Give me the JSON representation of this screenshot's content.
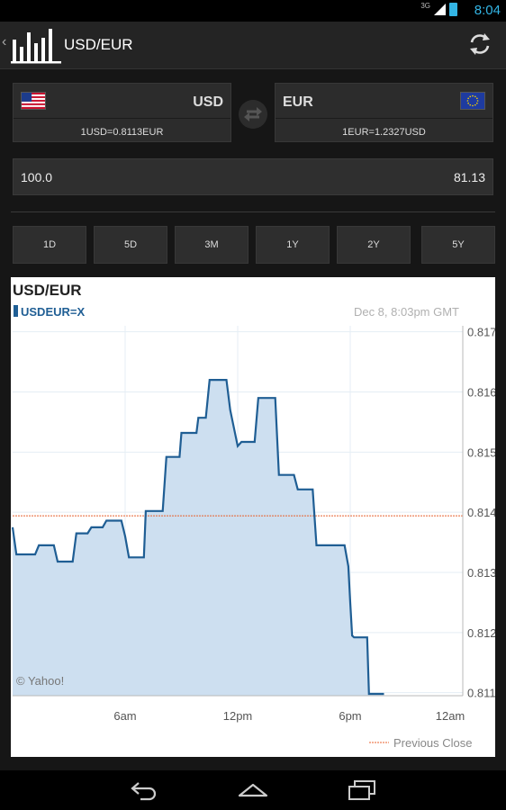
{
  "status_bar": {
    "network": "3G",
    "time": "8:04"
  },
  "action_bar": {
    "title": "USD/EUR"
  },
  "from": {
    "code": "USD",
    "rate": "1USD=0.8113EUR"
  },
  "to": {
    "code": "EUR",
    "rate": "1EUR=1.2327USD"
  },
  "amount": {
    "input": "100.0",
    "result": "81.13"
  },
  "periods": [
    "1D",
    "5D",
    "3M",
    "1Y",
    "2Y",
    "5Y"
  ],
  "chart_data": {
    "type": "area",
    "title": "USD/EUR",
    "series_label": "USDEUR=X",
    "timestamp": "Dec 8, 8:03pm GMT",
    "watermark": "© Yahoo!",
    "legend_label": "Previous Close",
    "previous_close": 0.81394,
    "ylim": [
      0.81095,
      0.8171
    ],
    "xlim": [
      0,
      24
    ],
    "y_ticks": [
      "0.817",
      "0.816",
      "0.815",
      "0.814",
      "0.813",
      "0.812",
      "0.811"
    ],
    "y_tick_values": [
      0.817,
      0.816,
      0.815,
      0.814,
      0.813,
      0.812,
      0.811
    ],
    "x_ticks": [
      "6am",
      "12pm",
      "6pm",
      "12am"
    ],
    "x_tick_values": [
      6,
      12,
      18,
      24
    ],
    "x": [
      0,
      0.2,
      1.2,
      1.4,
      2.2,
      2.4,
      3.2,
      3.4,
      4.0,
      4.2,
      4.8,
      5.0,
      5.8,
      6.0,
      6.2,
      7.0,
      7.1,
      8.0,
      8.2,
      8.9,
      9.0,
      9.8,
      9.9,
      10.3,
      10.5,
      11.4,
      11.6,
      12.0,
      12.2,
      12.9,
      13.1,
      14.0,
      14.2,
      15.0,
      15.2,
      16.0,
      16.2,
      17.7,
      17.9,
      18.0,
      18.1,
      18.2,
      18.9,
      19.0,
      19.2,
      19.8
    ],
    "values": [
      0.81375,
      0.8133,
      0.8133,
      0.81345,
      0.81345,
      0.81318,
      0.81318,
      0.81365,
      0.81365,
      0.81375,
      0.81375,
      0.81386,
      0.81386,
      0.8136,
      0.81325,
      0.81325,
      0.81402,
      0.81402,
      0.81492,
      0.81492,
      0.81532,
      0.81532,
      0.81557,
      0.81557,
      0.8162,
      0.8162,
      0.8157,
      0.8151,
      0.81517,
      0.81517,
      0.8159,
      0.8159,
      0.81462,
      0.81462,
      0.81438,
      0.81438,
      0.81345,
      0.81345,
      0.8131,
      0.8125,
      0.81195,
      0.81192,
      0.81192,
      0.81098,
      0.81098,
      0.81098
    ]
  }
}
